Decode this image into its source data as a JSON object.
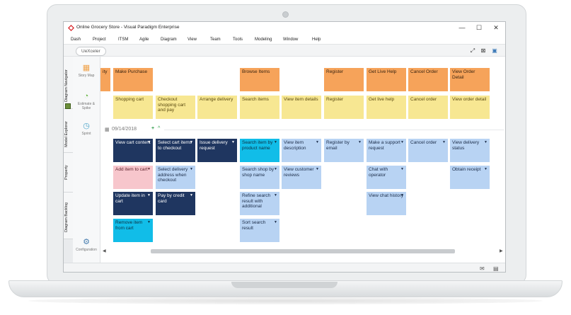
{
  "window": {
    "title": "Online Grocery Store - Visual Paradigm Enterprise",
    "min": "—",
    "max": "☐",
    "close": "✕"
  },
  "menu": [
    "Dash",
    "Project",
    "ITSM",
    "Agile",
    "Diagram",
    "View",
    "Team",
    "Tools",
    "Modeling",
    "Window",
    "Help"
  ],
  "tab": "UeXceler",
  "side_tabs": [
    "Diagram Navigator",
    "Model Explorer",
    "Property",
    "Diagram Backlog"
  ],
  "palette": [
    "Story Map",
    "Estimate & Spike",
    "Sprint",
    "Configuration"
  ],
  "date_label": "09/14/2018",
  "activities": [
    "Make Purchase",
    "Browse Items",
    "Register",
    "Get Live Help",
    "Cancel Order",
    "View Order Detail"
  ],
  "partial_activity": "ity",
  "tasks": [
    "Shopping cart",
    "Checkout shopping cart and pay",
    "Arrange delivery",
    "Search items",
    "View item details",
    "Register",
    "Get live help",
    "Cancel order",
    "View order detail"
  ],
  "stories": {
    "r1": [
      "View cart content",
      "Select cart items to checkout",
      "Issue delivery request",
      "Search item by product name",
      "View item description",
      "Register by email",
      "Make a support request",
      "Cancel order",
      "View delivery status"
    ],
    "r2": [
      "Add item to cart",
      "Select delivery address when checkout",
      "Search shop by shop name",
      "View customer reviews",
      "Chat with operator",
      "Obtain receipt"
    ],
    "r3": [
      "Update item in cart",
      "Pay by credit card",
      "Refine search result with additional",
      "View chat history"
    ],
    "r4": [
      "Remove item from cart",
      "Sort search result"
    ]
  },
  "colors": {
    "activity": "#f6a35a",
    "task": "#f7e792",
    "navy": "#1f3660",
    "blue": "#b8d3f3",
    "pink": "#f7c6cc",
    "cyan": "#11bde8"
  }
}
